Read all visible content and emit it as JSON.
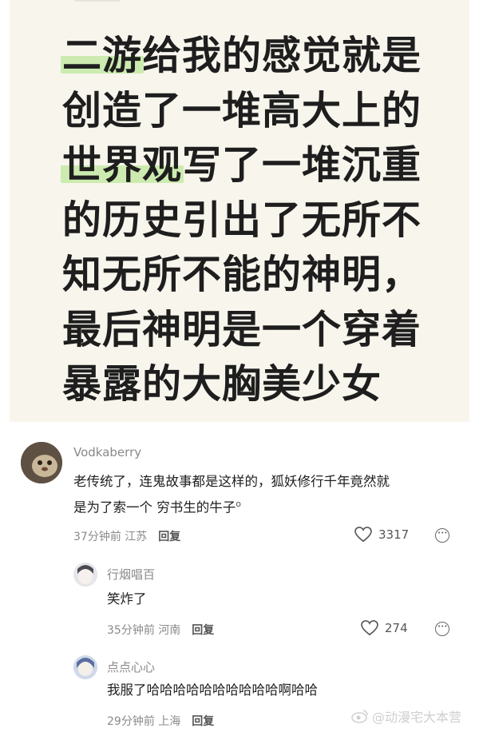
{
  "post": {
    "lines": [
      {
        "highlight": "二游",
        "rest": "给我的感觉就是"
      },
      {
        "highlight": "",
        "rest": "创造了一堆高大上的"
      },
      {
        "highlight": "世界观",
        "rest": "写了一堆沉重"
      },
      {
        "highlight": "",
        "rest": "的历史引出了无所不"
      },
      {
        "highlight": "",
        "rest": "知无所不能的神明，"
      },
      {
        "highlight": "",
        "rest": "最后神明是一个穿着"
      },
      {
        "highlight": "",
        "rest": "暴露的大胸美少女"
      }
    ],
    "highlight_color": "#cdebb0"
  },
  "comments": [
    {
      "username": "Vodkaberry",
      "text_line1": "老传统了，连鬼故事都是这样的，狐妖修行千年竟然就",
      "text_line2": "是为了索一个 穷书生的牛子",
      "meta": "37分钟前 江苏",
      "reply": "回复",
      "likes": "3317"
    },
    {
      "username": "行烟唱百",
      "text_line1": "笑炸了",
      "meta": "35分钟前 河南",
      "reply": "回复",
      "likes": "274"
    },
    {
      "username": "点点心心",
      "text_line1": "我服了哈哈哈哈哈哈哈哈哈哈啊哈哈",
      "meta": "29分钟前 上海",
      "reply": "回复"
    }
  ],
  "watermark": "@动漫宅大本营"
}
